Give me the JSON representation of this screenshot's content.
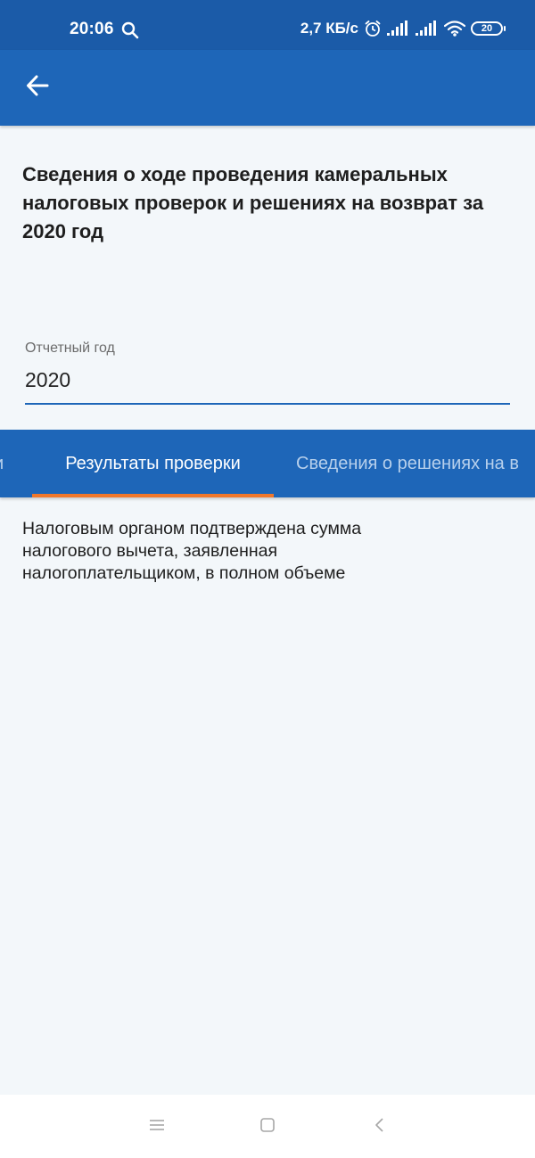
{
  "status_bar": {
    "time": "20:06",
    "speed": "2,7 КБ/с",
    "battery": "20",
    "icons": [
      "search-icon",
      "alarm-icon",
      "signal-icon",
      "signal-icon",
      "wifi-icon",
      "battery-icon"
    ]
  },
  "app_bar": {
    "back_icon": "arrow-left-icon",
    "color": "#1e66b8"
  },
  "page": {
    "title": "Сведения о ходе проведения камеральных налоговых проверок и решениях на возврат за 2020 год"
  },
  "report_year_field": {
    "label": "Отчетный год",
    "value": "2020"
  },
  "tabs": {
    "items": [
      {
        "label": "и"
      },
      {
        "label": "Результаты проверки"
      },
      {
        "label": "Сведения о решениях на в"
      }
    ],
    "active_index": 1,
    "indicator_color": "#f0772b"
  },
  "content": {
    "result_text": "Налоговым органом подтверждена сумма налогового вычета, заявленная налогоплательщиком, в полном объеме"
  },
  "nav_bar": {
    "icons": [
      "menu-icon",
      "home-square-icon",
      "back-chevron-icon"
    ]
  }
}
